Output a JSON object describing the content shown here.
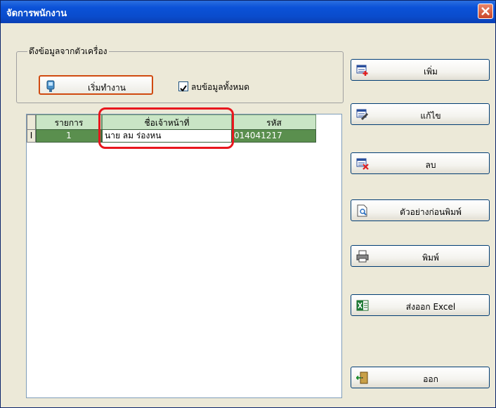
{
  "window": {
    "title": "จัดการพนักงาน"
  },
  "group": {
    "label": "ดึงข้อมูลจากตัวเครื่อง",
    "start_label": "เริ่มทำงาน",
    "delete_all_label": "ลบข้อมูลทั้งหมด",
    "delete_all_checked": true
  },
  "grid": {
    "columns": [
      "รายการ",
      "ชื่อเจ้าหน้าที่",
      "รหัส"
    ],
    "rows": [
      {
        "indicator": "I",
        "item": "1",
        "name": "นาย ลม ร่องหน",
        "code": "014041217"
      }
    ]
  },
  "buttons": {
    "add": "เพิ่ม",
    "edit": "แก้ไข",
    "delete": "ลบ",
    "preview": "ตัวอย่างก่อนพิมพ์",
    "print": "พิมพ์",
    "export_excel": "ส่งออก Excel",
    "exit": "ออก"
  },
  "colors": {
    "titlebar": "#0a4ccc",
    "grid_header": "#c9e5c5",
    "row_selected": "#5a8f4e",
    "highlight": "#e8161d"
  }
}
